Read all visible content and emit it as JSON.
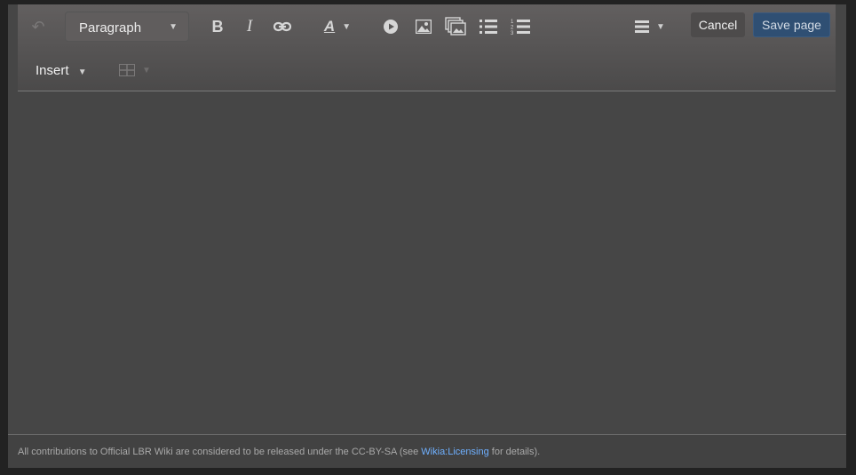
{
  "toolbar": {
    "format_select": {
      "value": "Paragraph"
    },
    "insert_label": "Insert",
    "cancel_label": "Cancel",
    "save_label": "Save page",
    "icons": [
      "undo-icon",
      "bold-icon",
      "italic-icon",
      "link-icon",
      "text-style-icon",
      "video-icon",
      "image-icon",
      "gallery-icon",
      "bullet-list-icon",
      "numbered-list-icon",
      "align-icon",
      "table-icon"
    ]
  },
  "footer": {
    "text_before": "All contributions to Official LBR Wiki are considered to be released under the CC-BY-SA (see ",
    "link": "Wikia:Licensing",
    "text_after": " for details)."
  },
  "colors": {
    "save_button": "#2f4f73",
    "link": "#6fb0ff"
  }
}
